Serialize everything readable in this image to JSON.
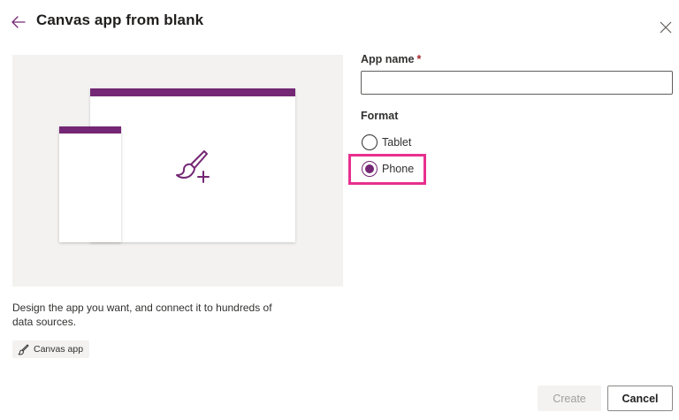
{
  "dialog": {
    "title": "Canvas app from blank",
    "back_icon": "arrow-left-icon",
    "close_icon": "close-icon"
  },
  "preview": {
    "accent_color": "#742774",
    "description": "Design the app you want, and connect it to hundreds of data sources.",
    "tag_label": "Canvas app",
    "tag_icon": "paintbrush-icon"
  },
  "form": {
    "app_name_label": "App name",
    "required_marker": "*",
    "app_name_value": "",
    "format_label": "Format",
    "options": [
      {
        "label": "Tablet",
        "selected": false
      },
      {
        "label": "Phone",
        "selected": true
      }
    ],
    "highlight_color": "#e8308f"
  },
  "footer": {
    "create_label": "Create",
    "create_enabled": false,
    "cancel_label": "Cancel"
  }
}
